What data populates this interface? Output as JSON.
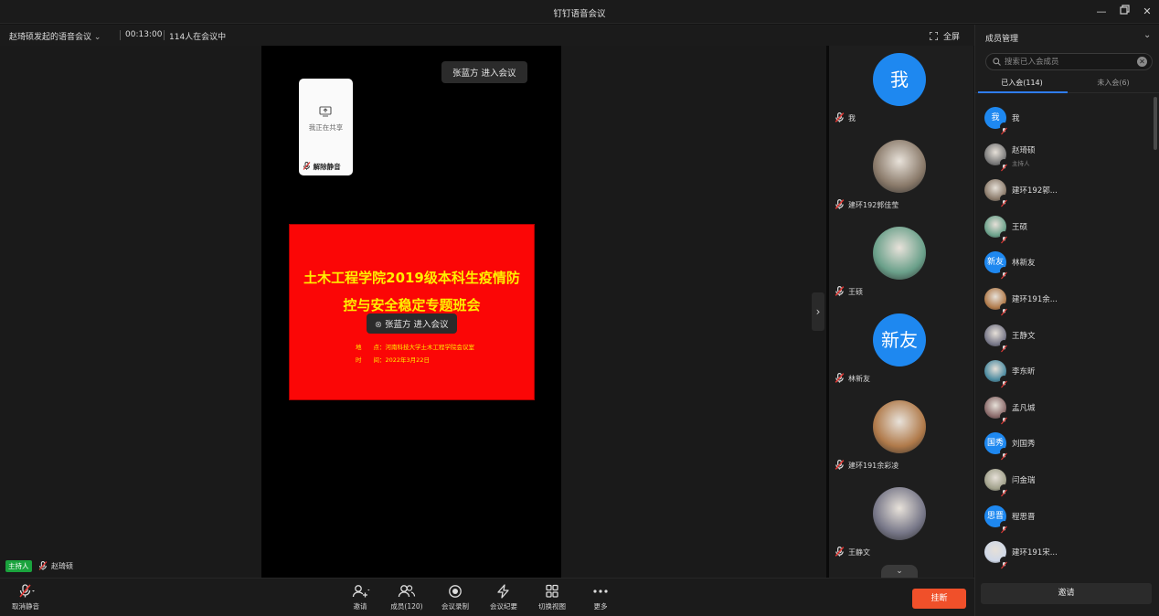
{
  "window": {
    "title": "钉钉语音会议"
  },
  "infobar": {
    "meeting_name": "赵琦硕发起的语音会议",
    "duration": "00:13:00",
    "count_text": "114人在会议中",
    "fullscreen_label": "全屏"
  },
  "share": {
    "card_text": "我正在共享",
    "unmute_text": "解除静音",
    "toast_top": "张蓝方 进入会议",
    "toast_center": "张蓝方 进入会议",
    "slide": {
      "title_line1": "土木工程学院2019级本科生疫情防",
      "title_line2": "控与安全稳定专题班会",
      "place": "地　　点：河南科技大学土木工程学院会议室",
      "time": "时　　间：2022年3月22日"
    },
    "host_badge": "主持人",
    "host_name": "赵琦硕"
  },
  "strip": {
    "tiles": [
      {
        "name": "我",
        "avatar_text": "我",
        "color": "#1e88f0"
      },
      {
        "name": "建环192郭佳莹",
        "avatar_text": "",
        "color": "#8a7a6a"
      },
      {
        "name": "王硕",
        "avatar_text": "",
        "color": "#6aa08a"
      },
      {
        "name": "林新友",
        "avatar_text": "新友",
        "color": "#1e88f0"
      },
      {
        "name": "建环191余彩凌",
        "avatar_text": "",
        "color": "#b07a4a"
      },
      {
        "name": "王静文",
        "avatar_text": "",
        "color": "#777788"
      }
    ]
  },
  "panel": {
    "title": "成员管理",
    "search_placeholder": "搜索已入会成员",
    "tab_joined": "已入会(114)",
    "tab_not_joined": "未入会(6)",
    "members": [
      {
        "name": "我",
        "sub": "",
        "avatar_text": "我",
        "color": "#1e88f0"
      },
      {
        "name": "赵琦硕",
        "sub": "主持人",
        "avatar_text": "",
        "color": "#7a7a7a"
      },
      {
        "name": "建环192郭...",
        "sub": "",
        "avatar_text": "",
        "color": "#8a7a6a"
      },
      {
        "name": "王硕",
        "sub": "",
        "avatar_text": "",
        "color": "#6aa08a"
      },
      {
        "name": "林新友",
        "sub": "",
        "avatar_text": "新友",
        "color": "#1e88f0"
      },
      {
        "name": "建环191余...",
        "sub": "",
        "avatar_text": "",
        "color": "#b07a4a"
      },
      {
        "name": "王静文",
        "sub": "",
        "avatar_text": "",
        "color": "#777788"
      },
      {
        "name": "李东昕",
        "sub": "",
        "avatar_text": "",
        "color": "#4a8aa0"
      },
      {
        "name": "孟凡城",
        "sub": "",
        "avatar_text": "",
        "color": "#8a6a6a"
      },
      {
        "name": "刘国秀",
        "sub": "",
        "avatar_text": "国秀",
        "color": "#1e88f0"
      },
      {
        "name": "闫金瑞",
        "sub": "",
        "avatar_text": "",
        "color": "#a0a08a"
      },
      {
        "name": "程思晋",
        "sub": "",
        "avatar_text": "思晋",
        "color": "#1e88f0"
      },
      {
        "name": "建环191宋...",
        "sub": "",
        "avatar_text": "",
        "color": "#cfd8e8"
      }
    ],
    "invite_label": "邀请"
  },
  "toolbar": {
    "mute_label": "取消静音",
    "invite_label": "邀请",
    "members_label": "成员(120)",
    "record_label": "会议录制",
    "minutes_label": "会议纪要",
    "view_label": "切换视图",
    "more_label": "更多",
    "hangup_label": "挂断"
  },
  "colors": {
    "accent": "#2f7df6",
    "hangup": "#f0502a",
    "host_badge": "#1aa33d",
    "slide_bg": "#fb0606",
    "slide_text": "#ffee00"
  }
}
